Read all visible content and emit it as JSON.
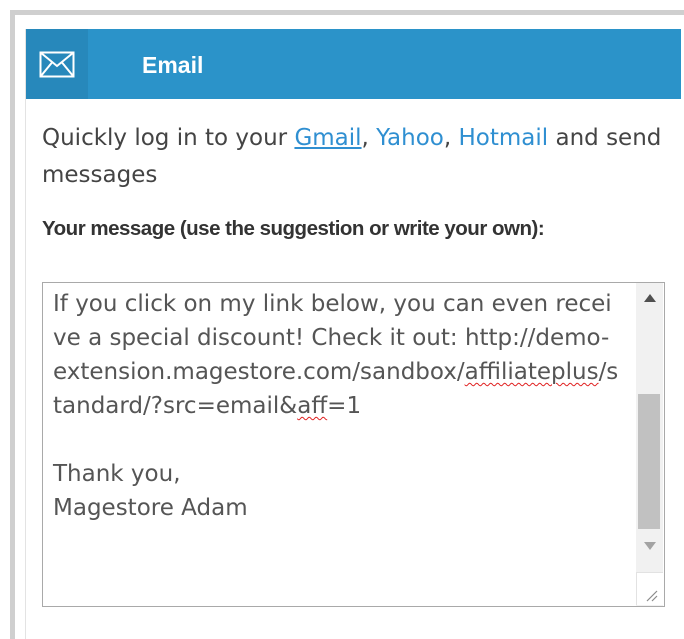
{
  "header": {
    "icon": "envelope-icon",
    "title": "Email",
    "colors": {
      "bar": "#2b93c9",
      "icon_box": "#2788bb"
    }
  },
  "intro": {
    "text_before": "Quickly log in to your ",
    "gmail_label": "Gmail",
    "sep1": ", ",
    "yahoo_label": "Yahoo",
    "sep2": ", ",
    "hotmail_label": "Hotmail",
    "text_after": " and send messages",
    "link_color": "#2f8fd1"
  },
  "message": {
    "label": "Your message (use the suggestion or write your own):",
    "text_part1": "If you click on my link below, you can even receive a special discount! Check it out: http://demo-extension.magestore.com/sandbox/",
    "text_affiliate": "affiliate",
    "text_plus": "plus",
    "text_part2": "/standard/?src=email&",
    "text_aff": "aff",
    "text_part3": "=1\n\nThank you,\nMagestore Adam",
    "scrollbar": {
      "up_icon": "triangle-up-icon",
      "down_icon": "triangle-down-icon",
      "resize_icon": "resize-grip-icon"
    }
  }
}
